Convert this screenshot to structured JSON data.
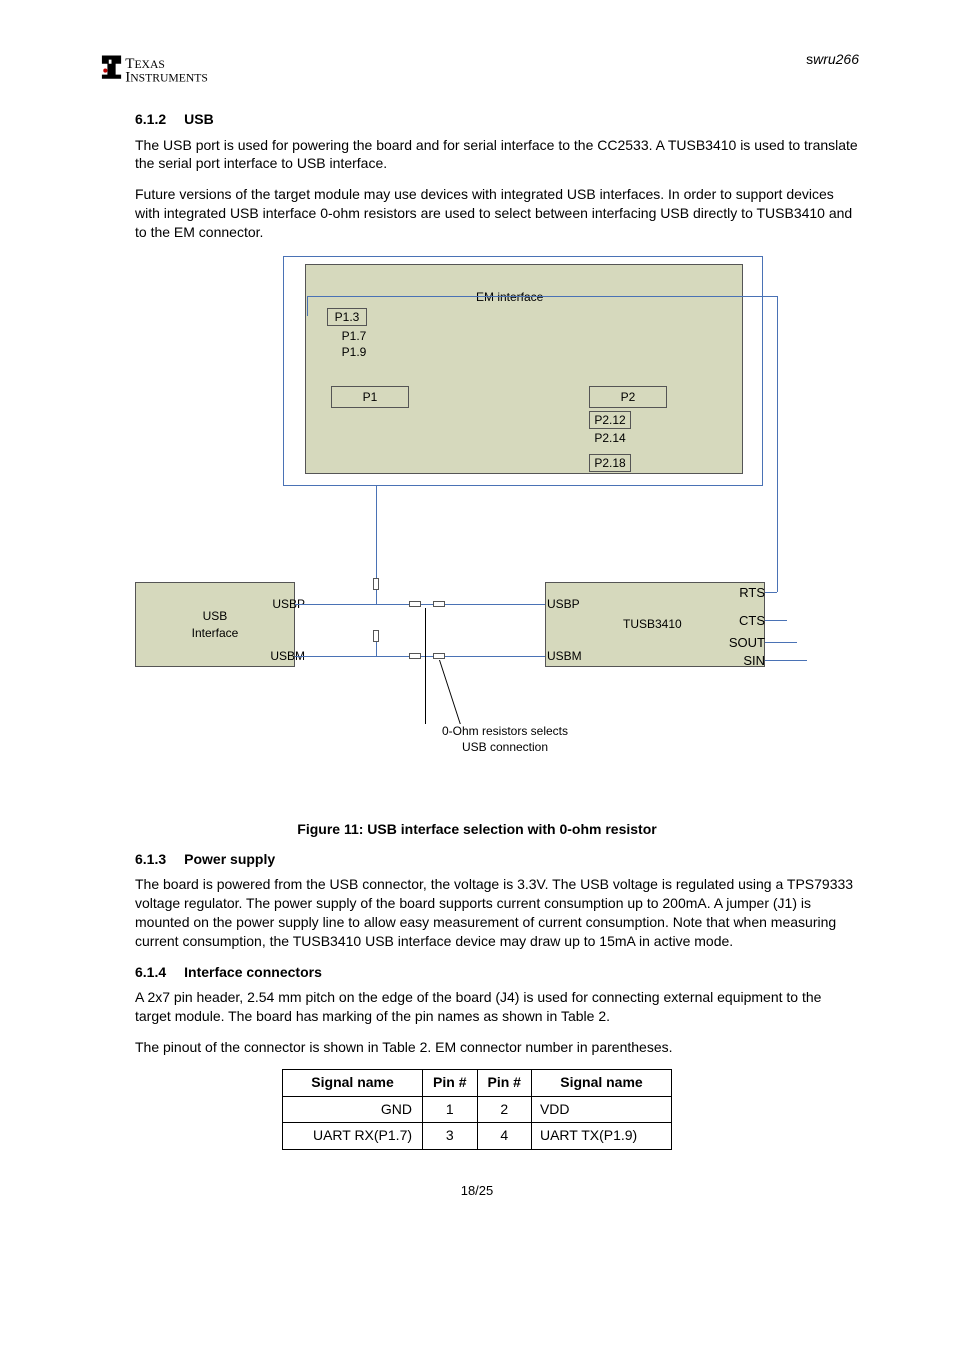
{
  "header": {
    "doc_id_prefix": "s",
    "doc_id": "wru266",
    "logo_text_top": "TEXAS",
    "logo_text_bottom": "INSTRUMENTS"
  },
  "s_usb": {
    "num": "6.1.2",
    "title": "USB",
    "p1": "The USB port is used for powering the board and for serial interface to the CC2533. A TUSB3410 is used to translate the serial port interface to USB interface.",
    "p2": "Future versions of the target module may use devices with integrated USB interfaces. In order to support devices with integrated USB interface 0-ohm resistors are used to select between interfacing USB directly to TUSB3410 and to the EM connector."
  },
  "diagram": {
    "em_interface": "EM interface",
    "p13": "P1.3",
    "p17": "P1.7",
    "p19": "P1.9",
    "p1": "P1",
    "p2": "P2",
    "p212": "P2.12",
    "p214": "P2.14",
    "p218": "P2.18",
    "usb_interface": "USB\nInterface",
    "usbp": "USBP",
    "usbm": "USBM",
    "tusb": "TUSB3410",
    "rts": "RTS",
    "cts": "CTS",
    "sout": "SOUT",
    "sin": "SIN",
    "ohm_label": "0-Ohm resistors selects\nUSB connection"
  },
  "fig11": "Figure 11: USB interface selection with 0-ohm resistor",
  "s_power": {
    "num": "6.1.3",
    "title": "Power supply",
    "p1": "The board is powered from the USB connector, the voltage is 3.3V. The USB voltage is regulated using a TPS79333 voltage regulator. The power supply of the board supports current consumption up to 200mA. A jumper (J1) is mounted on the power supply line to allow easy measurement of current consumption. Note that when measuring current consumption, the TUSB3410 USB interface device may draw up to 15mA in active mode."
  },
  "s_interface": {
    "num": "6.1.4",
    "title": "Interface connectors",
    "p1": "A 2x7 pin header, 2.54 mm pitch on the edge of the board (J4) is used for connecting external equipment to the target module. The board has marking of the pin names as shown in Table 2.",
    "p2": "The pinout of the connector is shown in Table 2. EM connector number in parentheses."
  },
  "table": {
    "h1": "Signal name",
    "h2": "Pin #",
    "h3": "Pin #",
    "h4": "Signal name",
    "rows": [
      {
        "sl": "GND",
        "p1": "1",
        "p2": "2",
        "sr": "VDD"
      },
      {
        "sl": "UART RX(P1.7)",
        "p1": "3",
        "p2": "4",
        "sr": "UART TX(P1.9)"
      }
    ]
  },
  "footer": {
    "page": "18/25"
  }
}
